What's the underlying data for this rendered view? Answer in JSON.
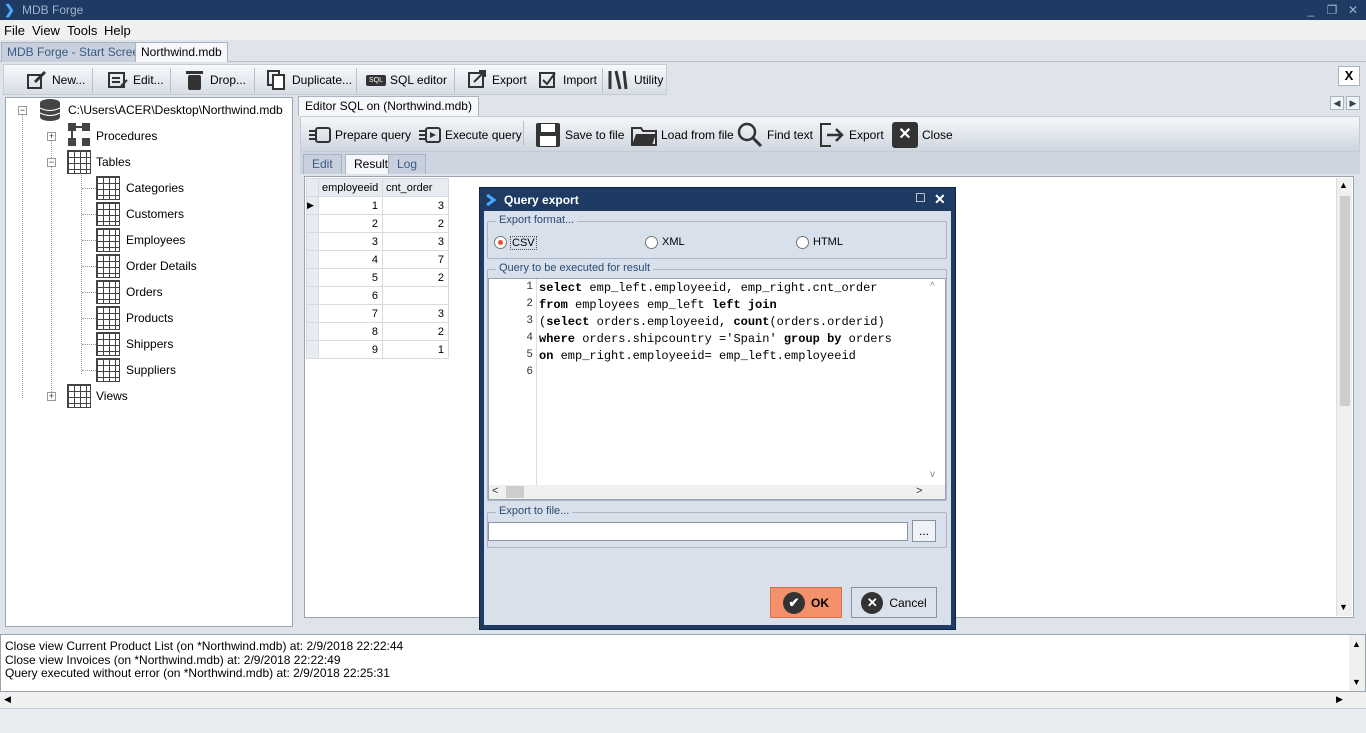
{
  "app": {
    "title": "MDB Forge",
    "window_buttons": [
      "_",
      "❐",
      "✕"
    ]
  },
  "menu": [
    "File",
    "View",
    "Tools",
    "Help"
  ],
  "doc_tabs": [
    {
      "label": "MDB Forge - Start Screen",
      "active": false
    },
    {
      "label": "Northwind.mdb",
      "active": true
    }
  ],
  "toolbar": [
    {
      "label": "New...",
      "icon": "edit-icon"
    },
    {
      "label": "Edit...",
      "icon": "list-edit-icon"
    },
    {
      "label": "Drop...",
      "icon": "trash-icon"
    },
    {
      "label": "Duplicate...",
      "icon": "duplicate-icon"
    },
    {
      "label": "SQL editor",
      "icon": "sql-icon",
      "badge": "SQL"
    },
    {
      "label": "Export",
      "icon": "export-icon"
    },
    {
      "label": "Import",
      "icon": "import-icon"
    },
    {
      "label": "Utility",
      "icon": "tools-icon"
    }
  ],
  "close_panel_label": "X",
  "tree": {
    "root": "C:\\Users\\ACER\\Desktop\\Northwind.mdb",
    "procedures": "Procedures",
    "tables": "Tables",
    "table_items": [
      "Categories",
      "Customers",
      "Employees",
      "Order Details",
      "Orders",
      "Products",
      "Shippers",
      "Suppliers"
    ],
    "views": "Views"
  },
  "editor": {
    "tab_label": "Editor SQL on (Northwind.mdb)",
    "toolbar": [
      {
        "label": "Prepare query",
        "icon": "prepare-query-icon"
      },
      {
        "label": "Execute query",
        "icon": "execute-query-icon"
      },
      {
        "label": "Save to file",
        "icon": "save-icon"
      },
      {
        "label": "Load from file",
        "icon": "folder-icon"
      },
      {
        "label": "Find text",
        "icon": "search-icon"
      },
      {
        "label": "Export",
        "icon": "export-icon"
      },
      {
        "label": "Close",
        "icon": "close-icon"
      }
    ],
    "sub_tabs": [
      {
        "label": "Edit",
        "active": false
      },
      {
        "label": "Result",
        "active": true
      },
      {
        "label": "Log",
        "active": false
      }
    ]
  },
  "result": {
    "columns": [
      "employeeid",
      "cnt_order"
    ],
    "rows": [
      [
        "1",
        "3"
      ],
      [
        "2",
        "2"
      ],
      [
        "3",
        "3"
      ],
      [
        "4",
        "7"
      ],
      [
        "5",
        "2"
      ],
      [
        "6",
        ""
      ],
      [
        "7",
        "3"
      ],
      [
        "8",
        "2"
      ],
      [
        "9",
        "1"
      ]
    ]
  },
  "dialog": {
    "title": "Query export",
    "format_group": "Export format...",
    "formats": [
      {
        "label": "CSV",
        "selected": true
      },
      {
        "label": "XML",
        "selected": false
      },
      {
        "label": "HTML",
        "selected": false
      }
    ],
    "query_group": "Query to be executed  for result",
    "code_lines": [
      [
        {
          "t": "select",
          "k": true
        },
        {
          "t": " emp_left.employeeid, emp_right.cnt_order",
          "k": false
        }
      ],
      [
        {
          "t": "from",
          "k": true
        },
        {
          "t": " employees emp_left ",
          "k": false
        },
        {
          "t": "left join",
          "k": true
        }
      ],
      [
        {
          "t": "(",
          "k": false
        },
        {
          "t": "select",
          "k": true
        },
        {
          "t": " orders.employeeid, ",
          "k": false
        },
        {
          "t": "count",
          "k": true
        },
        {
          "t": "(orders.orderid)",
          "k": false
        }
      ],
      [
        {
          "t": "where",
          "k": true
        },
        {
          "t": " orders.shipcountry ='Spain' ",
          "k": false
        },
        {
          "t": "group by",
          "k": true
        },
        {
          "t": " orders",
          "k": false
        }
      ],
      [
        {
          "t": "on",
          "k": true
        },
        {
          "t": " emp_right.employeeid= emp_left.employeeid",
          "k": false
        }
      ],
      []
    ],
    "file_group": "Export to file...",
    "file_value": "",
    "browse_label": "...",
    "ok_label": "OK",
    "cancel_label": "Cancel"
  },
  "log": [
    "Close view Current Product List (on *Northwind.mdb) at: 2/9/2018 22:22:44",
    "Close view Invoices (on *Northwind.mdb) at: 2/9/2018 22:22:49",
    "Query executed without error (on *Northwind.mdb) at: 2/9/2018 22:25:31"
  ],
  "colors": {
    "accent": "#1f3b63",
    "ok_button": "#f4916a",
    "radio_selected": "#e2542f"
  }
}
